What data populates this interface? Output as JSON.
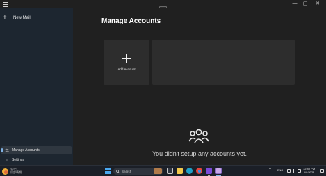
{
  "window": {
    "minimize_glyph": "—",
    "maximize_glyph": "▢",
    "close_glyph": "✕"
  },
  "sidebar": {
    "new_mail_icon": "+",
    "new_mail_label": "New Mail",
    "items": [
      {
        "label": "Manage Accounts",
        "icon": "people-icon",
        "selected": true
      },
      {
        "label": "Settings",
        "icon": "gear-icon",
        "selected": false
      }
    ]
  },
  "main": {
    "title": "Manage Accounts",
    "add_account_label": "Add Account",
    "empty_message": "You didn't setup any accounts yet."
  },
  "taskbar": {
    "weather_temp": "28°C",
    "weather_desc": "局部晴朗",
    "search_label": "Search",
    "tray_language": "ENG",
    "clock_time": "12:40 PM",
    "clock_date": "5/8/2024",
    "apps": [
      "task-view",
      "file-explorer",
      "edge",
      "chrome",
      "visual-studio",
      "mail"
    ]
  },
  "colors": {
    "accent": "#7fb2e5",
    "sidebar_bg": "#1d2630",
    "card_bg": "#2d2d2d",
    "main_bg": "#202020"
  }
}
